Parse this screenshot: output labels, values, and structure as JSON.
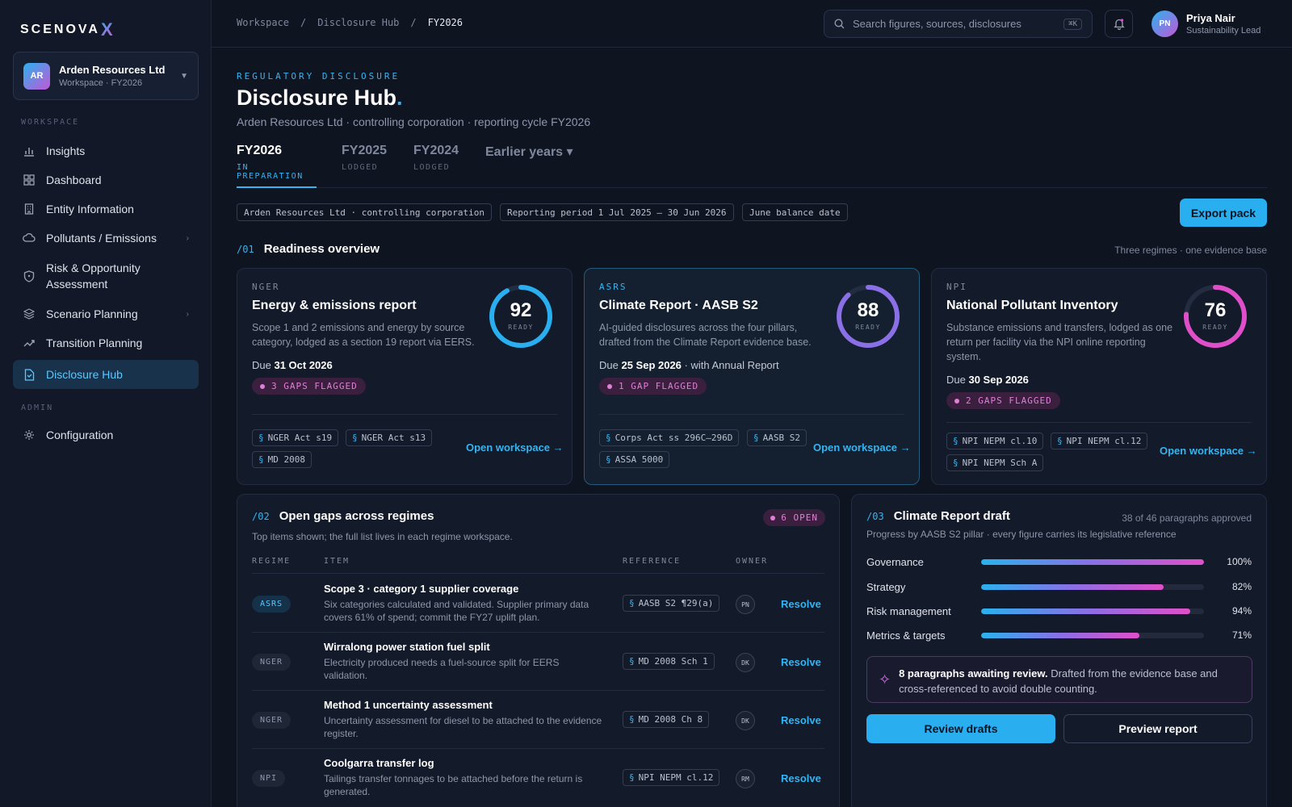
{
  "brand": {
    "name": "SCENOVA",
    "mark": "X"
  },
  "org": {
    "initials": "AR",
    "name": "Arden Resources Ltd",
    "sub": "Workspace · FY2026"
  },
  "sidebar": {
    "workspace_label": "WORKSPACE",
    "admin_label": "ADMIN",
    "items": [
      {
        "label": "Insights",
        "icon": "bar-chart-icon"
      },
      {
        "label": "Dashboard",
        "icon": "grid-icon"
      },
      {
        "label": "Entity Information",
        "icon": "building-icon"
      },
      {
        "label": "Pollutants / Emissions",
        "icon": "cloud-icon"
      },
      {
        "label": "Risk & Opportunity Assessment",
        "icon": "shield-icon"
      },
      {
        "label": "Scenario Planning",
        "icon": "layers-icon"
      },
      {
        "label": "Transition Planning",
        "icon": "trend-icon"
      },
      {
        "label": "Disclosure Hub",
        "icon": "document-icon"
      }
    ],
    "admin_items": [
      {
        "label": "Configuration",
        "icon": "gear-icon"
      }
    ]
  },
  "breadcrumb": [
    "Workspace",
    "Disclosure Hub",
    "FY2026"
  ],
  "search": {
    "placeholder": "Search figures, sources, disclosures",
    "shortcut": "⌘K"
  },
  "user": {
    "initials": "PN",
    "name": "Priya Nair",
    "role": "Sustainability Lead"
  },
  "header": {
    "eyebrow": "REGULATORY DISCLOSURE",
    "title": "Disclosure Hub",
    "subtitle": "Arden Resources Ltd · controlling corporation · reporting cycle FY2026"
  },
  "tabs": [
    {
      "label": "FY2026",
      "status": "IN PREPARATION"
    },
    {
      "label": "FY2025",
      "status": "LODGED"
    },
    {
      "label": "FY2024",
      "status": "LODGED"
    },
    {
      "label": "Earlier years ▾",
      "status": ""
    }
  ],
  "chips": [
    "Arden Resources Ltd · controlling corporation",
    "Reporting period 1 Jul 2025 – 30 Jun 2026",
    "June balance date"
  ],
  "export_label": "Export pack",
  "readiness": {
    "num": "/01",
    "title": "Readiness overview",
    "note": "Three regimes · one evidence base",
    "cards": [
      {
        "regime": "NGER",
        "title": "Energy & emissions report",
        "desc": "Scope 1 and 2 emissions and energy by source category, lodged as a section 19 report via EERS.",
        "due_prefix": "Due ",
        "due_date": "31 Oct 2026",
        "due_suffix": "",
        "gaps": "3 GAPS FLAGGED",
        "score": 92,
        "score_label": "READY",
        "color": "#29aef0",
        "refs": [
          "NGER Act s19",
          "NGER Act s13",
          "MD 2008"
        ],
        "link": "Open workspace →"
      },
      {
        "regime": "ASRS",
        "title": "Climate Report · AASB S2",
        "desc": "AI-guided disclosures across the four pillars, drafted from the Climate Report evidence base.",
        "due_prefix": "Due ",
        "due_date": "25 Sep 2026",
        "due_suffix": " · with Annual Report",
        "gaps": "1 GAP FLAGGED",
        "score": 88,
        "score_label": "READY",
        "color": "#8a6fe6",
        "refs": [
          "Corps Act ss 296C–296D",
          "AASB S2",
          "ASSA 5000"
        ],
        "link": "Open workspace →"
      },
      {
        "regime": "NPI",
        "title": "National Pollutant Inventory",
        "desc": "Substance emissions and transfers, lodged as one return per facility via the NPI online reporting system.",
        "due_prefix": "Due ",
        "due_date": "30 Sep 2026",
        "due_suffix": "",
        "gaps": "2 GAPS FLAGGED",
        "score": 76,
        "score_label": "READY",
        "color": "#e04fc9",
        "refs": [
          "NPI NEPM cl.10",
          "NPI NEPM cl.12",
          "NPI NEPM Sch A"
        ],
        "link": "Open workspace →"
      }
    ]
  },
  "gaps": {
    "num": "/02",
    "title": "Open gaps across regimes",
    "badge": "6 OPEN",
    "subtitle": "Top items shown; the full list lives in each regime workspace.",
    "headers": [
      "REGIME",
      "ITEM",
      "REFERENCE",
      "OWNER"
    ],
    "rows": [
      {
        "regime": "ASRS",
        "title": "Scope 3 · category 1 supplier coverage",
        "desc": "Six categories calculated and validated. Supplier primary data covers 61% of spend; commit the FY27 uplift plan.",
        "ref": "AASB S2 ¶29(a)",
        "owner": "PN",
        "action": "Resolve"
      },
      {
        "regime": "NGER",
        "title": "Wirralong power station fuel split",
        "desc": "Electricity produced needs a fuel-source split for EERS validation.",
        "ref": "MD 2008 Sch 1",
        "owner": "DK",
        "action": "Resolve"
      },
      {
        "regime": "NGER",
        "title": "Method 1 uncertainty assessment",
        "desc": "Uncertainty assessment for diesel to be attached to the evidence register.",
        "ref": "MD 2008 Ch 8",
        "owner": "DK",
        "action": "Resolve"
      },
      {
        "regime": "NPI",
        "title": "Coolgarra transfer log",
        "desc": "Tailings transfer tonnages to be attached before the return is generated.",
        "ref": "NPI NEPM cl.12",
        "owner": "RM",
        "action": "Resolve"
      }
    ]
  },
  "climate": {
    "num": "/03",
    "title": "Climate Report draft",
    "note": "38 of 46 paragraphs approved",
    "subtitle": "Progress by AASB S2 pillar · every figure carries its legislative reference",
    "pillars": [
      {
        "label": "Governance",
        "value": 100,
        "display": "100%"
      },
      {
        "label": "Strategy",
        "value": 82,
        "display": "82%"
      },
      {
        "label": "Risk management",
        "value": 94,
        "display": "94%"
      },
      {
        "label": "Metrics & targets",
        "value": 71,
        "display": "71%"
      }
    ],
    "await_bold": "8 paragraphs awaiting review.",
    "await_text": " Drafted from the evidence base and cross-referenced to avoid double counting.",
    "review_label": "Review drafts",
    "preview_label": "Preview report"
  }
}
